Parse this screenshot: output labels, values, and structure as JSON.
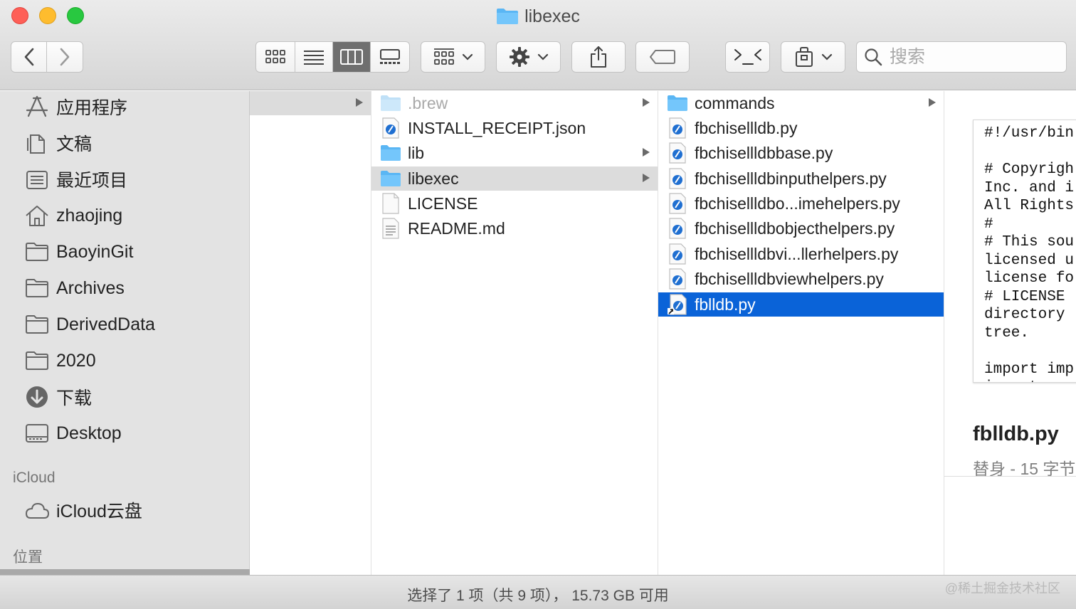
{
  "window": {
    "title": "libexec"
  },
  "toolbar": {
    "back": "chevron-left-icon",
    "forward": "chevron-right-icon",
    "views": [
      "icon-view",
      "list-view",
      "column-view",
      "gallery-view"
    ],
    "active_view": "column-view",
    "search_placeholder": "搜索"
  },
  "sidebar": {
    "favorites": [
      {
        "label": "应用程序",
        "icon": "applications-icon"
      },
      {
        "label": "文稿",
        "icon": "documents-icon"
      },
      {
        "label": "最近项目",
        "icon": "recents-icon"
      },
      {
        "label": "zhaojing",
        "icon": "home-icon"
      },
      {
        "label": "BaoyinGit",
        "icon": "folder-icon"
      },
      {
        "label": "Archives",
        "icon": "folder-icon"
      },
      {
        "label": "DerivedData",
        "icon": "folder-icon"
      },
      {
        "label": "2020",
        "icon": "folder-icon"
      },
      {
        "label": "下载",
        "icon": "downloads-icon"
      },
      {
        "label": "Desktop",
        "icon": "desktop-icon"
      }
    ],
    "icloud_header": "iCloud",
    "icloud_items": [
      {
        "label": "iCloud云盘",
        "icon": "cloud-icon"
      }
    ],
    "locations_header": "位置"
  },
  "columns": {
    "col2": [
      {
        "name": ".brew",
        "kind": "folder",
        "arrow": true,
        "dim": true
      },
      {
        "name": "INSTALL_RECEIPT.json",
        "kind": "script"
      },
      {
        "name": "lib",
        "kind": "folder",
        "arrow": true
      },
      {
        "name": "libexec",
        "kind": "folder",
        "arrow": true,
        "selected": true
      },
      {
        "name": "LICENSE",
        "kind": "blank"
      },
      {
        "name": "README.md",
        "kind": "text"
      }
    ],
    "col3": [
      {
        "name": "commands",
        "kind": "folder",
        "arrow": true
      },
      {
        "name": "fbchisellldb.py",
        "kind": "script"
      },
      {
        "name": "fbchisellldbbase.py",
        "kind": "script"
      },
      {
        "name": "fbchisellldbinputhelpers.py",
        "kind": "script"
      },
      {
        "name": "fbchisellldbo...imehelpers.py",
        "kind": "script"
      },
      {
        "name": "fbchisellldbobjecthelpers.py",
        "kind": "script"
      },
      {
        "name": "fbchisellldbvi...llerhelpers.py",
        "kind": "script"
      },
      {
        "name": "fbchisellldbviewhelpers.py",
        "kind": "script"
      },
      {
        "name": "fblldb.py",
        "kind": "script-alias",
        "selected": true
      }
    ]
  },
  "preview": {
    "code_text": "#!/usr/bin\n\n# Copyrigh\nInc. and i\nAll Rights\n#\n# This sou\nlicensed u\nlicense fo\n# LICENSE\ndirectory\ntree.\n\nimport imp\nimport os",
    "file_name": "fblldb.py",
    "file_meta": "替身 - 15 字节"
  },
  "status": {
    "text": "选择了 1 项（共 9 项）， 15.73 GB 可用",
    "watermark": "@稀土掘金技术社区"
  },
  "colors": {
    "selection_blue": "#0a63d8",
    "folder_blue": "#5ab6f4",
    "script_blue": "#1f6fd1"
  }
}
